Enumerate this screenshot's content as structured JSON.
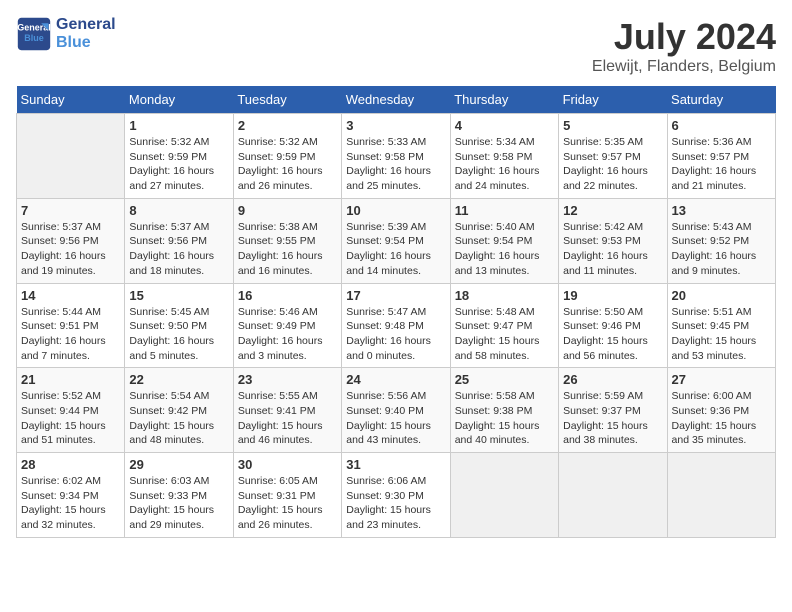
{
  "header": {
    "logo_line1": "General",
    "logo_line2": "Blue",
    "month_year": "July 2024",
    "location": "Elewijt, Flanders, Belgium"
  },
  "days_of_week": [
    "Sunday",
    "Monday",
    "Tuesday",
    "Wednesday",
    "Thursday",
    "Friday",
    "Saturday"
  ],
  "weeks": [
    [
      {
        "day": "",
        "empty": true
      },
      {
        "day": "1",
        "sunrise": "5:32 AM",
        "sunset": "9:59 PM",
        "daylight": "16 hours and 27 minutes."
      },
      {
        "day": "2",
        "sunrise": "5:32 AM",
        "sunset": "9:59 PM",
        "daylight": "16 hours and 26 minutes."
      },
      {
        "day": "3",
        "sunrise": "5:33 AM",
        "sunset": "9:58 PM",
        "daylight": "16 hours and 25 minutes."
      },
      {
        "day": "4",
        "sunrise": "5:34 AM",
        "sunset": "9:58 PM",
        "daylight": "16 hours and 24 minutes."
      },
      {
        "day": "5",
        "sunrise": "5:35 AM",
        "sunset": "9:57 PM",
        "daylight": "16 hours and 22 minutes."
      },
      {
        "day": "6",
        "sunrise": "5:36 AM",
        "sunset": "9:57 PM",
        "daylight": "16 hours and 21 minutes."
      }
    ],
    [
      {
        "day": "7",
        "sunrise": "5:37 AM",
        "sunset": "9:56 PM",
        "daylight": "16 hours and 19 minutes."
      },
      {
        "day": "8",
        "sunrise": "5:37 AM",
        "sunset": "9:56 PM",
        "daylight": "16 hours and 18 minutes."
      },
      {
        "day": "9",
        "sunrise": "5:38 AM",
        "sunset": "9:55 PM",
        "daylight": "16 hours and 16 minutes."
      },
      {
        "day": "10",
        "sunrise": "5:39 AM",
        "sunset": "9:54 PM",
        "daylight": "16 hours and 14 minutes."
      },
      {
        "day": "11",
        "sunrise": "5:40 AM",
        "sunset": "9:54 PM",
        "daylight": "16 hours and 13 minutes."
      },
      {
        "day": "12",
        "sunrise": "5:42 AM",
        "sunset": "9:53 PM",
        "daylight": "16 hours and 11 minutes."
      },
      {
        "day": "13",
        "sunrise": "5:43 AM",
        "sunset": "9:52 PM",
        "daylight": "16 hours and 9 minutes."
      }
    ],
    [
      {
        "day": "14",
        "sunrise": "5:44 AM",
        "sunset": "9:51 PM",
        "daylight": "16 hours and 7 minutes."
      },
      {
        "day": "15",
        "sunrise": "5:45 AM",
        "sunset": "9:50 PM",
        "daylight": "16 hours and 5 minutes."
      },
      {
        "day": "16",
        "sunrise": "5:46 AM",
        "sunset": "9:49 PM",
        "daylight": "16 hours and 3 minutes."
      },
      {
        "day": "17",
        "sunrise": "5:47 AM",
        "sunset": "9:48 PM",
        "daylight": "16 hours and 0 minutes."
      },
      {
        "day": "18",
        "sunrise": "5:48 AM",
        "sunset": "9:47 PM",
        "daylight": "15 hours and 58 minutes."
      },
      {
        "day": "19",
        "sunrise": "5:50 AM",
        "sunset": "9:46 PM",
        "daylight": "15 hours and 56 minutes."
      },
      {
        "day": "20",
        "sunrise": "5:51 AM",
        "sunset": "9:45 PM",
        "daylight": "15 hours and 53 minutes."
      }
    ],
    [
      {
        "day": "21",
        "sunrise": "5:52 AM",
        "sunset": "9:44 PM",
        "daylight": "15 hours and 51 minutes."
      },
      {
        "day": "22",
        "sunrise": "5:54 AM",
        "sunset": "9:42 PM",
        "daylight": "15 hours and 48 minutes."
      },
      {
        "day": "23",
        "sunrise": "5:55 AM",
        "sunset": "9:41 PM",
        "daylight": "15 hours and 46 minutes."
      },
      {
        "day": "24",
        "sunrise": "5:56 AM",
        "sunset": "9:40 PM",
        "daylight": "15 hours and 43 minutes."
      },
      {
        "day": "25",
        "sunrise": "5:58 AM",
        "sunset": "9:38 PM",
        "daylight": "15 hours and 40 minutes."
      },
      {
        "day": "26",
        "sunrise": "5:59 AM",
        "sunset": "9:37 PM",
        "daylight": "15 hours and 38 minutes."
      },
      {
        "day": "27",
        "sunrise": "6:00 AM",
        "sunset": "9:36 PM",
        "daylight": "15 hours and 35 minutes."
      }
    ],
    [
      {
        "day": "28",
        "sunrise": "6:02 AM",
        "sunset": "9:34 PM",
        "daylight": "15 hours and 32 minutes."
      },
      {
        "day": "29",
        "sunrise": "6:03 AM",
        "sunset": "9:33 PM",
        "daylight": "15 hours and 29 minutes."
      },
      {
        "day": "30",
        "sunrise": "6:05 AM",
        "sunset": "9:31 PM",
        "daylight": "15 hours and 26 minutes."
      },
      {
        "day": "31",
        "sunrise": "6:06 AM",
        "sunset": "9:30 PM",
        "daylight": "15 hours and 23 minutes."
      },
      {
        "day": "",
        "empty": true
      },
      {
        "day": "",
        "empty": true
      },
      {
        "day": "",
        "empty": true
      }
    ]
  ]
}
